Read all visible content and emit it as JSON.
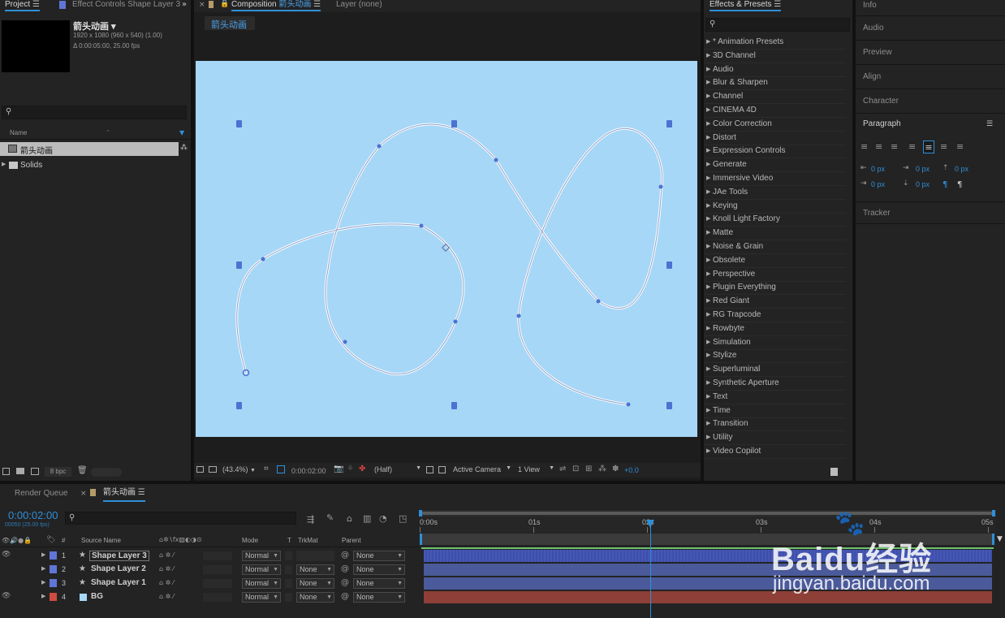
{
  "project_panel": {
    "tab_label": "Project",
    "effect_controls_tab": "Effect Controls Shape Layer 3",
    "comp_name": "箭头动画 ▾",
    "comp_size": "1920 x 1080 (960 x 540) (1.00)",
    "comp_duration": "Δ 0:00:05:00, 25.00 fps",
    "search_placeholder": "",
    "column_name": "Name",
    "items": [
      {
        "label": "箭头动画"
      },
      {
        "label": "Solids"
      }
    ],
    "bpc": "8 bpc"
  },
  "composition_panel": {
    "tab_label": "Composition",
    "tab_comp_name": "箭头动画",
    "layer_tab": "Layer (none)",
    "flowchart_label": "箭头动画",
    "zoom": "(43.4%)",
    "timecode": "0:00:02:00",
    "resolution": "(Half)",
    "camera": "Active Camera",
    "view": "1 View",
    "exposure": "+0.0"
  },
  "effects_panel": {
    "title": "Effects & Presets",
    "items": [
      "* Animation Presets",
      "3D Channel",
      "Audio",
      "Blur & Sharpen",
      "Channel",
      "CINEMA 4D",
      "Color Correction",
      "Distort",
      "Expression Controls",
      "Generate",
      "Immersive Video",
      "JAe Tools",
      "Keying",
      "Knoll Light Factory",
      "Matte",
      "Noise & Grain",
      "Obsolete",
      "Perspective",
      "Plugin Everything",
      "Red Giant",
      "RG Trapcode",
      "Rowbyte",
      "Simulation",
      "Stylize",
      "Superluminal",
      "Synthetic Aperture",
      "Text",
      "Time",
      "Transition",
      "Utility",
      "Video Copilot"
    ]
  },
  "right_panel": {
    "items": [
      "Info",
      "Audio",
      "Preview",
      "Align",
      "Character"
    ],
    "paragraph_title": "Paragraph",
    "px_values": [
      "0 px",
      "0 px",
      "0 px",
      "0 px",
      "0 px"
    ],
    "tracker": "Tracker"
  },
  "timeline": {
    "render_queue_tab": "Render Queue",
    "comp_tab": "箭头动画",
    "timecode": "0:00:02:00",
    "frame_info": "00050 (25.00 fps)",
    "columns": {
      "source_name": "Source Name",
      "mode": "Mode",
      "t": "T",
      "trkmat": "TrkMat",
      "parent": "Parent",
      "hash": "#"
    },
    "ruler": [
      "0:00s",
      "01s",
      "02s",
      "03s",
      "04s",
      "05s"
    ],
    "layers": [
      {
        "num": "1",
        "name": "Shape Layer 3",
        "mode": "Normal",
        "trkmat": "",
        "parent": "None",
        "label_color": "#5f76d6",
        "bar_color": "#3d4fae"
      },
      {
        "num": "2",
        "name": "Shape Layer 2",
        "mode": "Normal",
        "trkmat": "None",
        "parent": "None",
        "label_color": "#5f76d6",
        "bar_color": "#4a5a9a"
      },
      {
        "num": "3",
        "name": "Shape Layer 1",
        "mode": "Normal",
        "trkmat": "None",
        "parent": "None",
        "label_color": "#5f76d6",
        "bar_color": "#4a5a9a"
      },
      {
        "num": "4",
        "name": "BG",
        "mode": "Normal",
        "trkmat": "None",
        "parent": "None",
        "label_color": "#cc4c3f",
        "bar_color": "#8e3f38"
      }
    ]
  },
  "colors": {
    "accent": "#2f8fd8",
    "canvas": "#a7d7f7",
    "path_handle": "#4c72d2"
  },
  "watermark": {
    "brand": "Baidu经验",
    "url": "jingyan.baidu.com"
  }
}
